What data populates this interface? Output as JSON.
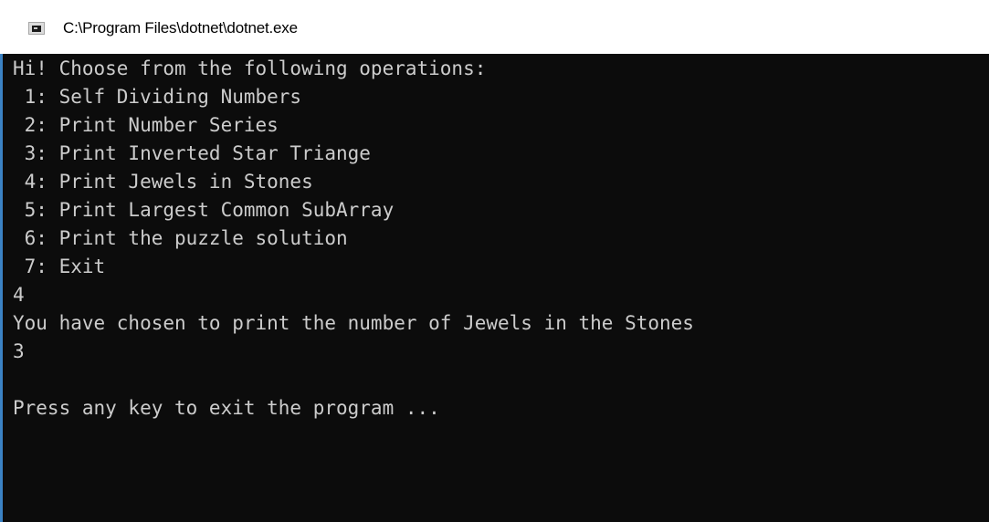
{
  "window": {
    "title": "C:\\Program Files\\dotnet\\dotnet.exe",
    "icon": "console-app-icon"
  },
  "console": {
    "lines": [
      "Hi! Choose from the following operations:",
      " 1: Self Dividing Numbers",
      " 2: Print Number Series",
      " 3: Print Inverted Star Triange",
      " 4: Print Jewels in Stones",
      " 5: Print Largest Common SubArray",
      " 6: Print the puzzle solution",
      " 7: Exit",
      "4",
      "You have chosen to print the number of Jewels in the Stones",
      "3",
      "",
      "Press any key to exit the program ..."
    ]
  },
  "colors": {
    "background": "#0c0c0c",
    "text": "#cccccc",
    "titlebar": "#ffffff",
    "focus_border": "#3b82c4"
  }
}
